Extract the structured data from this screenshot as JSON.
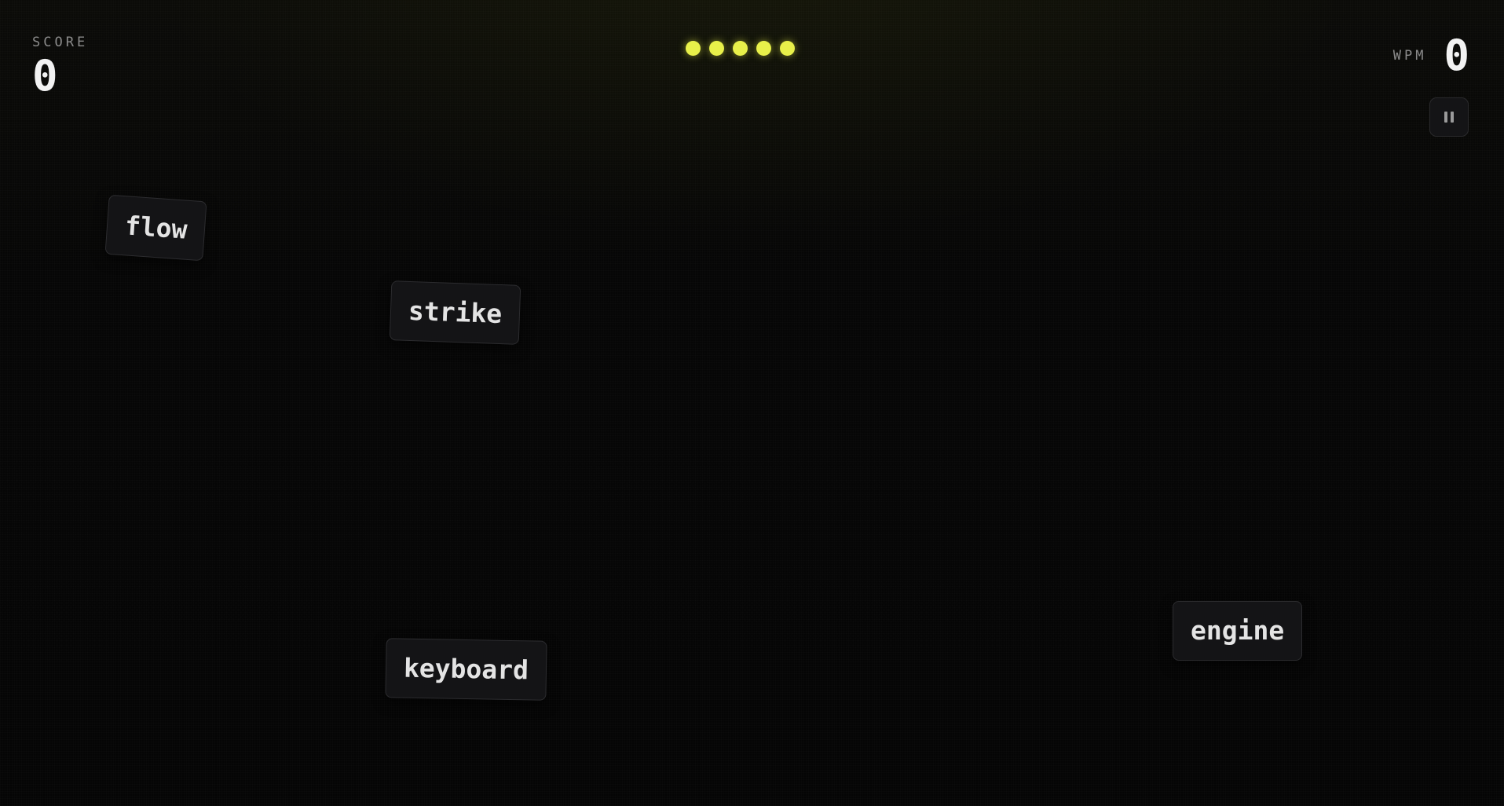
{
  "hud": {
    "score_label": "SCORE",
    "score_value": "0",
    "wpm_label": "WPM",
    "wpm_value": "0",
    "lives_count": 5,
    "lives_color": "#e8f04a"
  },
  "controls": {
    "pause_icon": "pause-icon"
  },
  "words": [
    {
      "text": "flow"
    },
    {
      "text": "strike"
    },
    {
      "text": "keyboard"
    },
    {
      "text": "engine"
    }
  ]
}
